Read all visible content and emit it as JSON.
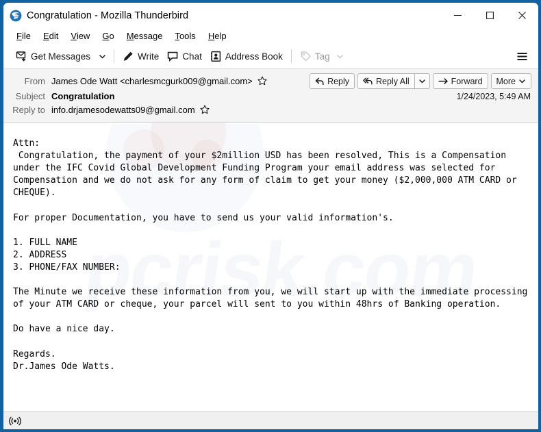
{
  "window": {
    "title": "Congratulation - Mozilla Thunderbird",
    "app_icon": "thunderbird-icon",
    "controls": {
      "minimize": "minimize-icon",
      "maximize": "maximize-icon",
      "close": "close-icon"
    }
  },
  "menubar": {
    "items": [
      {
        "label": "File",
        "accesskey": "F"
      },
      {
        "label": "Edit",
        "accesskey": "E"
      },
      {
        "label": "View",
        "accesskey": "V"
      },
      {
        "label": "Go",
        "accesskey": "G"
      },
      {
        "label": "Message",
        "accesskey": "M"
      },
      {
        "label": "Tools",
        "accesskey": "T"
      },
      {
        "label": "Help",
        "accesskey": "H"
      }
    ]
  },
  "toolbar": {
    "get_messages": "Get Messages",
    "write": "Write",
    "chat": "Chat",
    "address_book": "Address Book",
    "tag": "Tag",
    "tag_disabled": true,
    "app_menu": "app-menu-icon"
  },
  "message_header": {
    "from_label": "From",
    "from_value": "James Ode Watt <charlesmcgurk009@gmail.com>",
    "subject_label": "Subject",
    "subject_value": "Congratulation",
    "reply_to_label": "Reply to",
    "reply_to_value": "info.drjamesodewatts09@gmail.com",
    "date": "1/24/2023, 5:49 AM",
    "actions": {
      "reply": "Reply",
      "reply_all": "Reply All",
      "forward": "Forward",
      "more": "More"
    }
  },
  "message_body": {
    "watermark": "pcrisk.com",
    "text": "Attn:\n Congratulation, the payment of your $2million USD has been resolved, This is a Compensation under the IFC Covid Global Development Funding Program your email address was selected for Compensation and we do not ask for any form of claim to get your money ($2,000,000 ATM CARD or CHEQUE).\n\nFor proper Documentation, you have to send us your valid information's.\n\n1. FULL NAME\n2. ADDRESS\n3. PHONE/FAX NUMBER:\n\nThe Minute we receive these information from you, we will start up with the immediate processing of your ATM CARD or cheque, your parcel will sent to you within 48hrs of Banking operation.\n\nDo have a nice day.\n\nRegards.\nDr.James Ode Watts."
  },
  "statusbar": {
    "icon": "network-activity-icon",
    "text": ""
  },
  "colors": {
    "window_border": "#1261a0",
    "header_bg": "#f4f4f4",
    "body_bg": "#ffffff",
    "text": "#000000",
    "label_text": "#646464"
  }
}
